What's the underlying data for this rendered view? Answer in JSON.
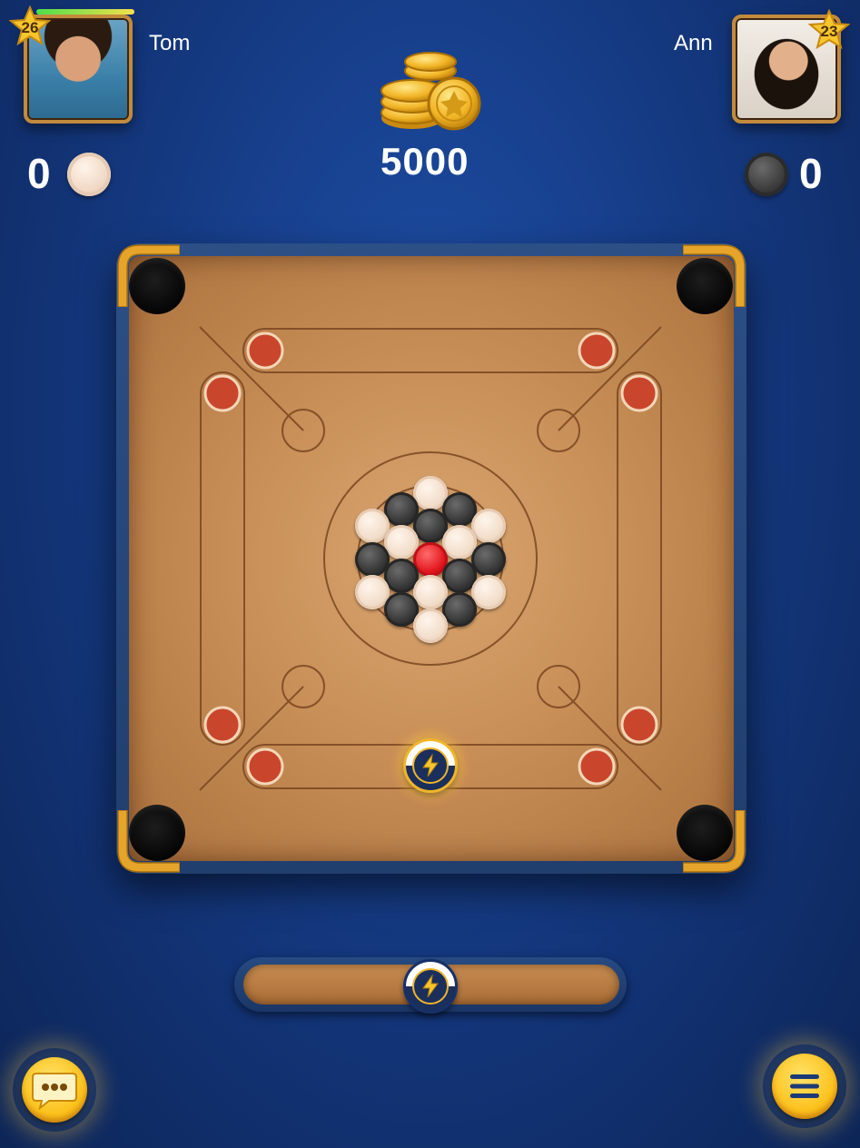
{
  "players": {
    "left": {
      "name": "Tom",
      "level": "26",
      "score": "0",
      "coin_color": "white"
    },
    "right": {
      "name": "Ann",
      "level": "23",
      "score": "0",
      "coin_color": "black"
    }
  },
  "pot": {
    "amount": "5000",
    "icon": "coin-stack-icon"
  },
  "board": {
    "colors": {
      "wood": "#c98f58",
      "frame": "#203e6e",
      "queen": "#e0141c",
      "accent": "#f0b52a"
    },
    "striker_icon": "lightning-icon"
  },
  "controls": {
    "chat_icon": "chat-bubble-icon",
    "menu_icon": "hamburger-menu-icon",
    "power_slider_icon": "lightning-icon"
  }
}
